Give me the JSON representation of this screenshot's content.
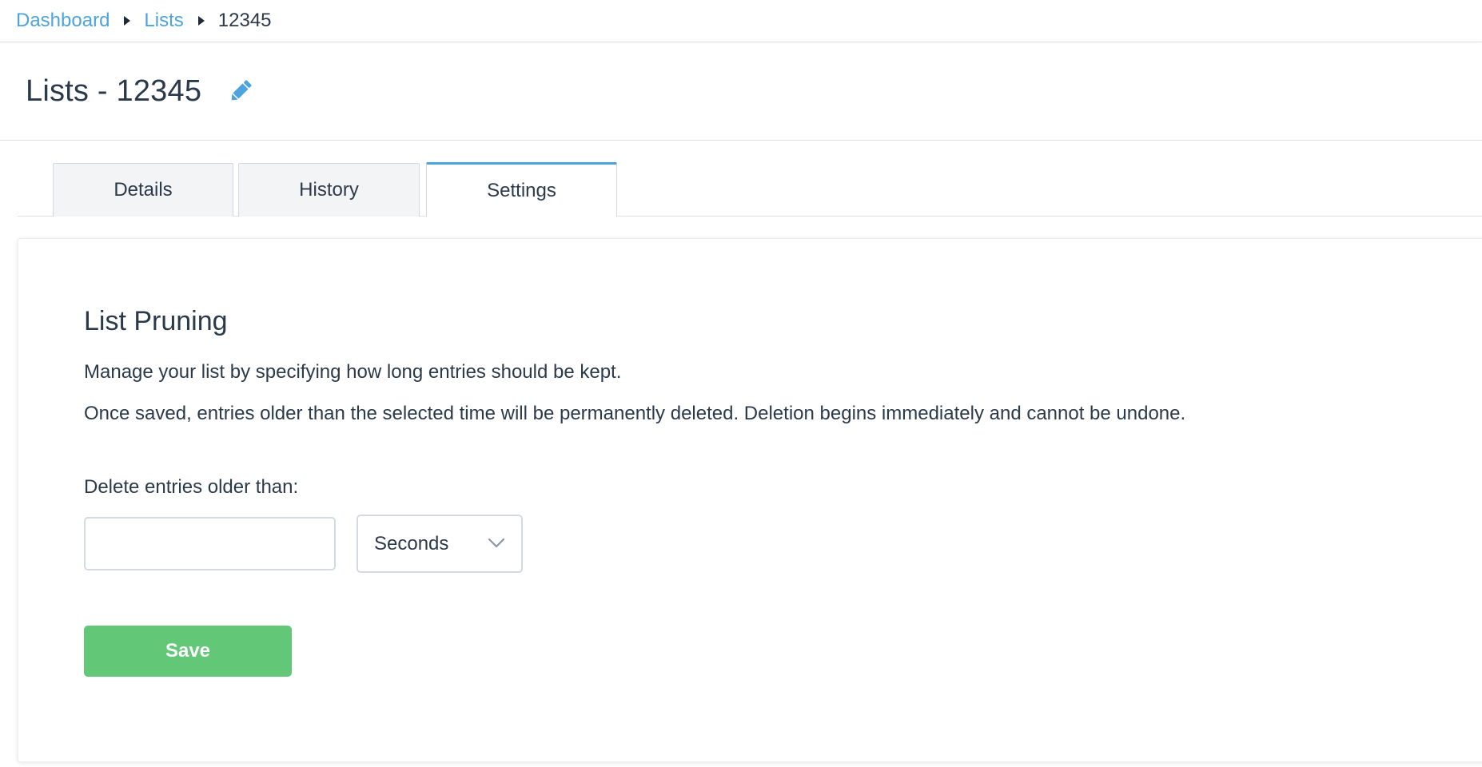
{
  "breadcrumb": {
    "items": [
      {
        "label": "Dashboard"
      },
      {
        "label": "Lists"
      },
      {
        "label": "12345"
      }
    ]
  },
  "header": {
    "title": "Lists - 12345",
    "edit_icon": "pencil-icon"
  },
  "tabs": [
    {
      "label": "Details",
      "active": false
    },
    {
      "label": "History",
      "active": false
    },
    {
      "label": "Settings",
      "active": true
    }
  ],
  "settings": {
    "section_title": "List Pruning",
    "description_1": "Manage your list by specifying how long entries should be kept.",
    "description_2": "Once saved, entries older than the selected time will be permanently deleted. Deletion begins immediately and cannot be undone.",
    "field_label": "Delete entries older than:",
    "amount_value": "",
    "unit_selected": "Seconds",
    "save_label": "Save"
  },
  "colors": {
    "link": "#4da3dd",
    "active_tab_border": "#4da3dd",
    "save_button": "#62c777",
    "text": "#2b3a4a"
  }
}
